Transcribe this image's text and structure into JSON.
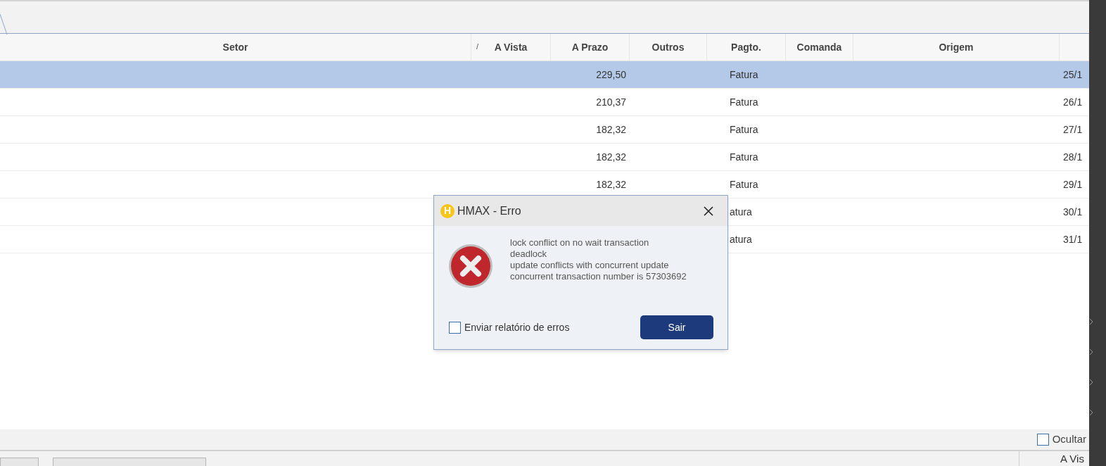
{
  "table": {
    "columns": [
      {
        "label": "Setor"
      },
      {
        "label": "A Vista",
        "sort_mark": "/"
      },
      {
        "label": "A Prazo"
      },
      {
        "label": "Outros"
      },
      {
        "label": "Pagto."
      },
      {
        "label": "Comanda"
      },
      {
        "label": "Origem"
      },
      {}
    ],
    "rows": [
      {
        "selected": true,
        "a_prazo": "229,50",
        "pagto": "Fatura",
        "column_8": "25/1"
      },
      {
        "selected": false,
        "a_prazo": "210,37",
        "pagto": "Fatura",
        "column_8": "26/1"
      },
      {
        "selected": false,
        "a_prazo": "182,32",
        "pagto": "Fatura",
        "column_8": "27/1"
      },
      {
        "selected": false,
        "a_prazo": "182,32",
        "pagto": "Fatura",
        "column_8": "28/1"
      },
      {
        "selected": false,
        "a_prazo": "182,32",
        "pagto": "Fatura",
        "column_8": "29/1"
      },
      {
        "selected": false,
        "pagto": "atura",
        "column_8": "30/1"
      },
      {
        "selected": false,
        "pagto": "atura",
        "column_8": "31/1"
      }
    ]
  },
  "footer": {
    "hide_checkbox": {
      "label": "Ocultar",
      "checked": false
    },
    "column_label": "A Vis"
  },
  "dialog": {
    "title": "HMAX - Erro",
    "logo_letter": "H",
    "message_lines": [
      "lock conflict on no wait transaction",
      "deadlock",
      "update conflicts with concurrent update",
      "concurrent transaction number is 57303692"
    ],
    "send_report": {
      "label": "Enviar relatório de erros",
      "checked": false
    },
    "button": "Sair"
  }
}
